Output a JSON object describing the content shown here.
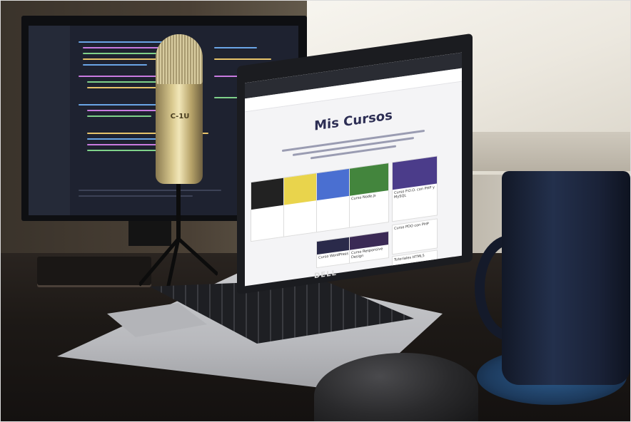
{
  "photo": {
    "description_tags": []
  },
  "laptop_screen": {
    "page_title": "Mis Cursos",
    "cards": [
      {
        "title": "Curso Node.js"
      },
      {
        "title": "Curso P.O.O. con PHP y MySQL"
      },
      {
        "title": "Curso PDO con PHP"
      },
      {
        "title": "Curso Responsive Design"
      },
      {
        "title": "Curso WordPress"
      },
      {
        "title": "Tutoriales HTML5"
      }
    ]
  },
  "laptop_brand": "DELL",
  "mic_label": "C-1U",
  "colors": {
    "screen_bg": "#f4f4f6",
    "title": "#2d2e54",
    "mug": "#1a2238"
  }
}
